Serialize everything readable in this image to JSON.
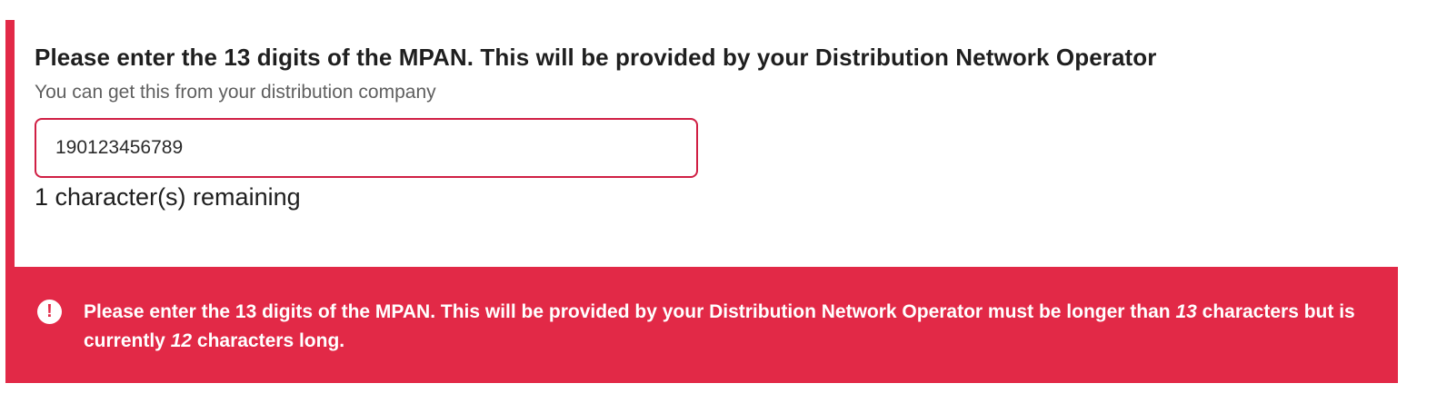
{
  "question": {
    "title": "Please enter the 13 digits of the MPAN. This will be provided by your Distribution Network Operator",
    "hint": "You can get this from your distribution company",
    "input_value": "190123456789",
    "char_remaining": "1 character(s) remaining"
  },
  "error": {
    "icon": "exclamation-circle-icon",
    "message_part1": "Please enter the 13 digits of the MPAN. This will be provided by your Distribution Network Operator must be longer than ",
    "min_length": "13",
    "message_part2": " characters but is currently ",
    "current_length": "12",
    "message_part3": " characters long.",
    "icon_glyph": "!"
  },
  "colors": {
    "error_red": "#e22947",
    "input_border": "#d01f44",
    "text_dark": "#1f1f1f",
    "text_hint": "#5f5f5f"
  }
}
